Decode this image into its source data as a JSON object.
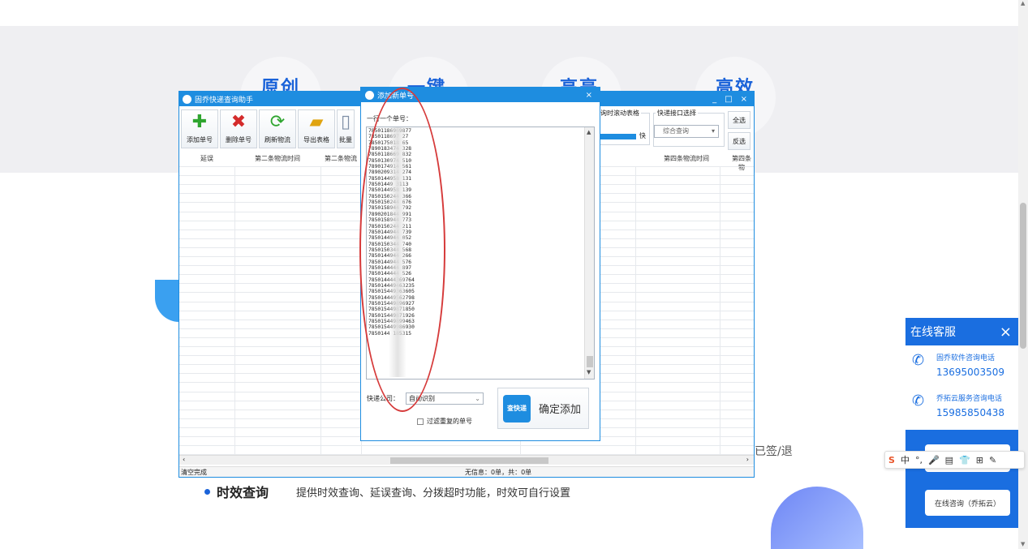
{
  "page": {
    "features": [
      "原创",
      "一键",
      "高亮",
      "高效"
    ],
    "signed_text": "已签/退",
    "feature_title": "时效查询",
    "feature_desc": "提供时效查询、延误查询、分拨超时功能，时效可自行设置"
  },
  "app": {
    "title": "固乔快递查询助手",
    "window_controls": [
      "_",
      "□",
      "×"
    ],
    "toolbar": [
      {
        "label": "添加单号",
        "icon": "plus-icon",
        "color": "#2fa52f"
      },
      {
        "label": "删除单号",
        "icon": "x-icon",
        "color": "#d42b2b"
      },
      {
        "label": "刷新物流",
        "icon": "refresh-icon",
        "color": "#2fa52f"
      },
      {
        "label": "导出表格",
        "icon": "folder-icon",
        "color": "#e0a410"
      },
      {
        "label": "批量",
        "icon": "doc-icon",
        "color": "#7f8fa6"
      }
    ],
    "scroll_group_label": "询时滚动表格",
    "scroll_fast": "快",
    "interface_group_label": "快递接口选择",
    "interface_select": "综合查询",
    "select_all": "全选",
    "invert_select": "反选",
    "columns": [
      "延误",
      "第二条物流时间",
      "第二条物流",
      "第四条物流时间",
      "第四条物"
    ],
    "status_left": "清空完成",
    "status_mid": "无信息：0单，共：0单"
  },
  "dialog": {
    "title": "添加新单号",
    "close": "×",
    "prompt": "一行一个单号：",
    "tracking_numbers": [
      "78501186969877",
      "7850118697 27",
      "7850175018 65",
      "7890183474 328",
      "7850118669 832",
      "7850130974 510",
      "7890174914 561",
      "7890209314 274",
      "7850144958 131",
      "78501449 3113",
      "7850144958 139",
      "7850150244 366",
      "7850150244 676",
      "7850158944 792",
      "7890201844 991",
      "7850158944 773",
      "7850150244 211",
      "7850144944 739",
      "7850144944 052",
      "7850150344 740",
      "7850150344 568",
      "7850144944 266",
      "7850144944 576",
      "7850144444 897",
      "7850144444 526",
      "785014444369764",
      "785014449463235",
      "785015449363605",
      "785014449562798",
      "785015449896927",
      "785015449871850",
      "785015449871926",
      "785015449899463",
      "785015449986930",
      "7850144 185315"
    ],
    "express_label": "快递公司：",
    "express_value": "自动识别",
    "filter_label": "过滤重复的单号",
    "confirm_label": "确定添加",
    "confirm_logo": "查快递"
  },
  "service": {
    "title": "在线客服",
    "close": "×",
    "items": [
      {
        "label": "固乔软件咨询电话",
        "phone": "13695003509"
      },
      {
        "label": "乔拓云服务咨询电话",
        "phone": "15985850438"
      }
    ],
    "consult_button": "在线咨询（乔拓云）"
  },
  "ime": {
    "logo": "S",
    "items": [
      "中",
      "°,",
      "🎤",
      "▤",
      "👕",
      "⊞",
      "✎"
    ]
  }
}
